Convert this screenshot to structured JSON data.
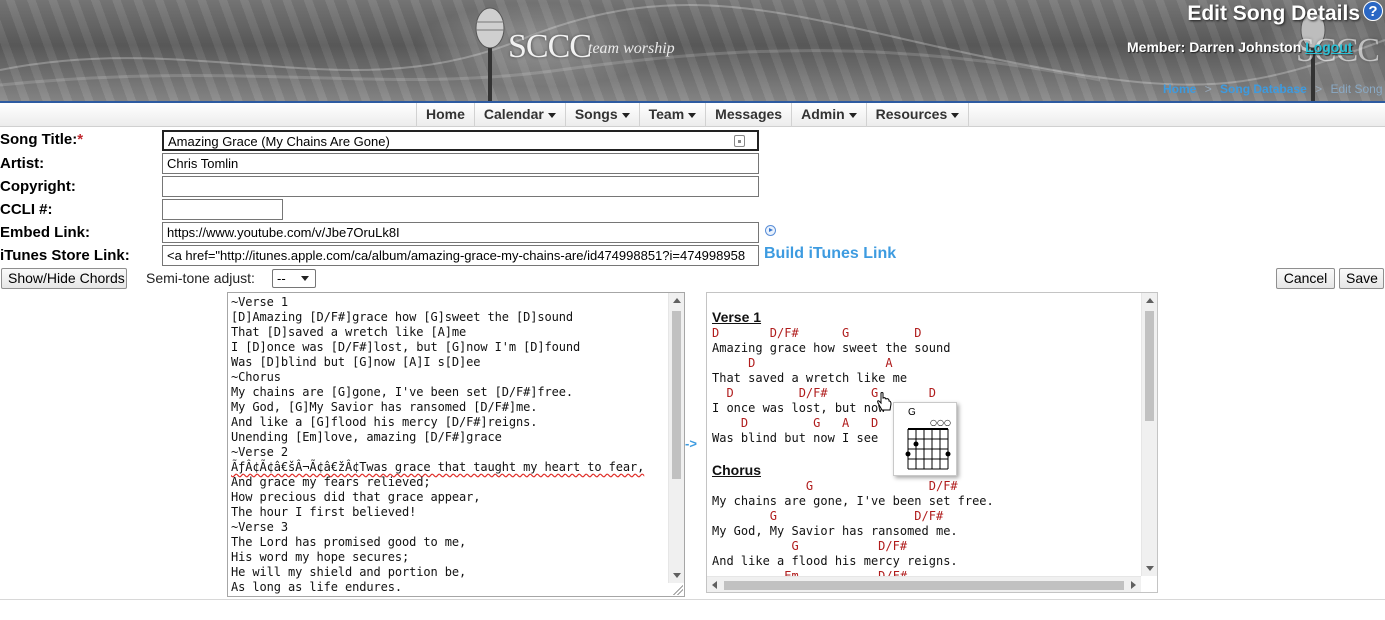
{
  "header": {
    "logo_text": "SCCC",
    "logo_sub": "team worship",
    "page_title": "Edit Song Details",
    "help_label": "?",
    "member_label": "Member: Darren Johnston",
    "logout_label": "Logout",
    "breadcrumb": {
      "home": "Home",
      "song_db": "Song Database",
      "current": "Edit Song",
      "separator": ">"
    }
  },
  "nav": {
    "items": [
      {
        "label": "Home",
        "dropdown": false
      },
      {
        "label": "Calendar",
        "dropdown": true
      },
      {
        "label": "Songs",
        "dropdown": true
      },
      {
        "label": "Team",
        "dropdown": true
      },
      {
        "label": "Messages",
        "dropdown": false
      },
      {
        "label": "Admin",
        "dropdown": true
      },
      {
        "label": "Resources",
        "dropdown": true
      }
    ]
  },
  "form": {
    "title_label": "Song Title:",
    "required_mark": "*",
    "title_value": "Amazing Grace (My Chains Are Gone)",
    "artist_label": "Artist:",
    "artist_value": "Chris Tomlin",
    "copyright_label": "Copyright:",
    "copyright_value": "",
    "ccli_label": "CCLI #:",
    "ccli_value": "",
    "embed_label": "Embed Link:",
    "embed_value": "https://www.youtube.com/v/Jbe7OruLk8I",
    "itunes_label": "iTunes Store Link:",
    "itunes_value": "<a href=\"http://itunes.apple.com/ca/album/amazing-grace-my-chains-are/id474998851?i=474998958",
    "build_itunes_label": "Build iTunes Link"
  },
  "controls": {
    "show_hide_chords": "Show/Hide Chords",
    "semitone_label": "Semi-tone adjust:",
    "semitone_value": "--",
    "cancel": "Cancel",
    "save": "Save",
    "arrow": "->"
  },
  "editor": {
    "lines": [
      "~Verse 1",
      "[D]Amazing [D/F#]grace how [G]sweet the [D]sound",
      "That [D]saved a wretch like [A]me",
      "I [D]once was [D/F#]lost, but [G]now I'm [D]found",
      "Was [D]blind but [G]now [A]I s[D]ee",
      "~Chorus",
      "My chains are [G]gone, I've been set [D/F#]free.",
      "My God, [G]My Savior has ransomed [D/F#]me.",
      "And like a [G]flood his mercy [D/F#]reigns.",
      "Unending [Em]love, amazing [D/F#]grace",
      "~Verse 2",
      "ÃƒÂ¢Ã¢â€šÂ¬Ã¢â€žÂ¢Twas grace that taught my heart to fear,",
      "And grace my fears relieved;",
      "How precious did that grace appear,",
      "The hour I first believed!",
      "~Verse 3",
      "The Lord has promised good to me,",
      "His word my hope secures;",
      "He will my shield and portion be,",
      "As long as life endures."
    ]
  },
  "preview": {
    "sections": [
      {
        "title": "Verse 1",
        "rows": [
          {
            "chords": "D       D/F#      G         D",
            "lyric": "Amazing grace how sweet the sound"
          },
          {
            "chords": "     D                  A",
            "lyric": "That saved a wretch like me"
          },
          {
            "chords": "  D         D/F#      G       D",
            "lyric": "I once was lost, but now I'm found"
          },
          {
            "chords": "    D         G   A   D",
            "lyric": "Was blind but now I see"
          }
        ]
      },
      {
        "title": "Chorus",
        "rows": [
          {
            "chords": "             G                D/F#",
            "lyric": "My chains are gone, I've been set free."
          },
          {
            "chords": "        G                   D/F#",
            "lyric": "My God, My Savior has ransomed me."
          },
          {
            "chords": "           G           D/F#",
            "lyric": "And like a flood his mercy reigns."
          },
          {
            "chords": "          Em           D/F#",
            "lyric": ""
          }
        ]
      }
    ],
    "chord_popup": {
      "name": "G",
      "open_marks": "○○○"
    }
  }
}
